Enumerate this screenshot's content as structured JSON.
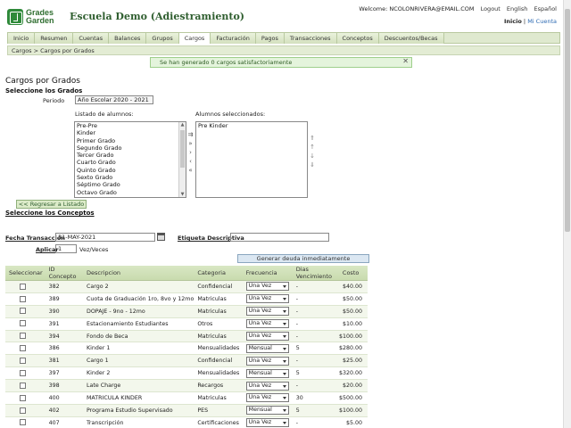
{
  "brand": {
    "logo_line1": "Grades",
    "logo_line2": "Garden",
    "school": "Escuela Demo (Adiestramiento)"
  },
  "topbar": {
    "welcome": "Welcome: NCOLONRIVERA@EMAIL.COM",
    "logout": "Logout",
    "english": "English",
    "espanol": "Español",
    "inicio": "Inicio",
    "separator": "|",
    "mi_cuenta": "Mi Cuenta"
  },
  "nav": [
    "Inicio",
    "Resumen",
    "Cuentas",
    "Balances",
    "Grupos",
    "Cargos",
    "Facturación",
    "Pagos",
    "Transacciones",
    "Conceptos",
    "Descuentos/Becas"
  ],
  "breadcrumb": "Cargos > Cargos por Grados",
  "flash": {
    "message": "Se han generado 0 cargos satisfactoriamente",
    "close": "✕"
  },
  "page": {
    "title": "Cargos por Grados",
    "section_grades": "Seleccione los Grados",
    "periodo_label": "Periodo",
    "periodo_value": "Año Escolar 2020 - 2021",
    "list_label": "Listado de alumnos:",
    "selected_label": "Alumnos seleccionados:",
    "students": [
      "Pre-Pre",
      "Kinder",
      "Primer Grado",
      "Segundo Grado",
      "Tercer Grado",
      "Cuarto Grado",
      "Quinto Grado",
      "Sexto Grado",
      "Séptimo Grado",
      "Octavo Grado"
    ],
    "selected": [
      "Pre Kinder"
    ],
    "back_button": "<< Regresar a Listado",
    "section_concepts": "Seleccione los Conceptos",
    "fecha_label": "Fecha Transacción",
    "fecha_value": "31-MAY-2021",
    "etiqueta_label": "Etiqueta Descriptiva",
    "aplicar_label": "Aplicar",
    "aplicar_value": "1",
    "aplicar_tail": "Vez/Veces",
    "generate_button": "Generar deuda inmediatamente"
  },
  "table": {
    "headers": [
      "Seleccionar",
      "ID Concepto",
      "Descripcion",
      "Categoria",
      "Frecuencia",
      "Dias Vencimiento",
      "Costo"
    ],
    "rows": [
      {
        "id": "382",
        "desc": "Cargo 2",
        "cat": "Confidencial",
        "freq": "Una Vez",
        "dias": "-",
        "costo": "$40.00"
      },
      {
        "id": "389",
        "desc": "Cuota de Graduación 1ro, 8vo y 12mo",
        "cat": "Matriculas",
        "freq": "Una Vez",
        "dias": "-",
        "costo": "$50.00"
      },
      {
        "id": "390",
        "desc": "DOPAJE - 9no - 12mo",
        "cat": "Matriculas",
        "freq": "Una Vez",
        "dias": "-",
        "costo": "$50.00"
      },
      {
        "id": "391",
        "desc": "Estacionamiento Estudiantes",
        "cat": "Otros",
        "freq": "Una Vez",
        "dias": "-",
        "costo": "$10.00"
      },
      {
        "id": "394",
        "desc": "Fondo de Beca",
        "cat": "Matriculas",
        "freq": "Una Vez",
        "dias": "-",
        "costo": "$100.00"
      },
      {
        "id": "386",
        "desc": "Kinder 1",
        "cat": "Mensualidades",
        "freq": "Mensual",
        "dias": "5",
        "costo": "$280.00"
      },
      {
        "id": "381",
        "desc": "Cargo 1",
        "cat": "Confidencial",
        "freq": "Una Vez",
        "dias": "-",
        "costo": "$25.00"
      },
      {
        "id": "397",
        "desc": "Kinder 2",
        "cat": "Mensualidades",
        "freq": "Mensual",
        "dias": "5",
        "costo": "$320.00"
      },
      {
        "id": "398",
        "desc": "Late Charge",
        "cat": "Recargos",
        "freq": "Una Vez",
        "dias": "-",
        "costo": "$20.00"
      },
      {
        "id": "400",
        "desc": "MATRICULA KINDER",
        "cat": "Matriculas",
        "freq": "Una Vez",
        "dias": "30",
        "costo": "$500.00"
      },
      {
        "id": "402",
        "desc": "Programa Estudio Supervisado",
        "cat": "PES",
        "freq": "Mensual",
        "dias": "5",
        "costo": "$100.00"
      },
      {
        "id": "407",
        "desc": "Transcripción",
        "cat": "Certificaciones",
        "freq": "Una Vez",
        "dias": "-",
        "costo": "$5.00"
      }
    ]
  }
}
